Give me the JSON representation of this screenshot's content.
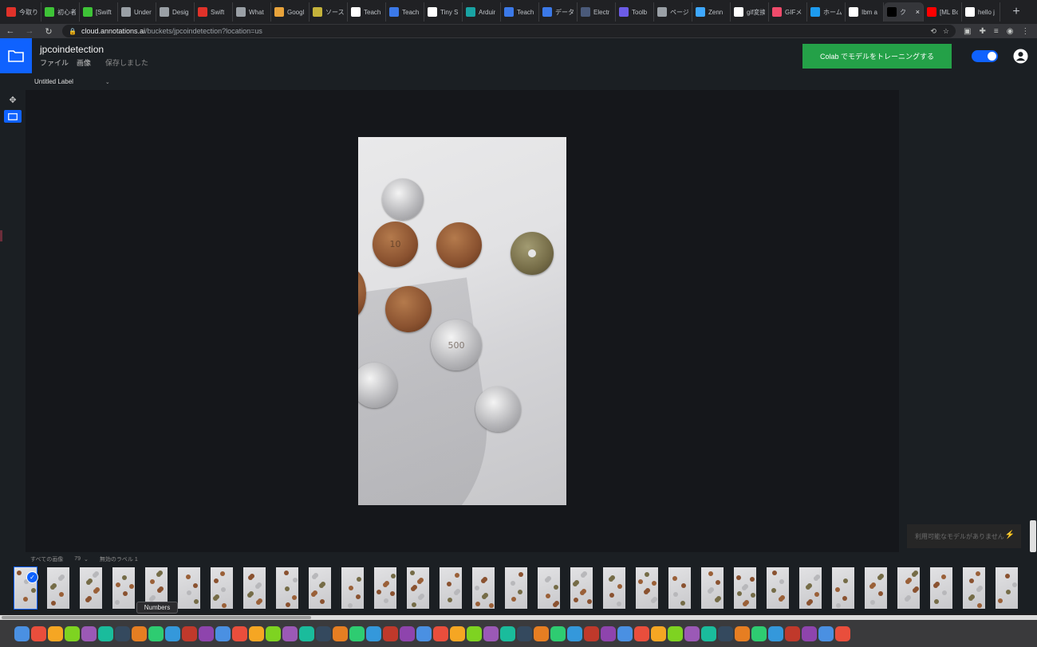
{
  "browser": {
    "tabs": [
      {
        "label": "今取り",
        "color": "#e0322a"
      },
      {
        "label": "初心者",
        "color": "#3ec337"
      },
      {
        "label": "[Swift",
        "color": "#3ec337"
      },
      {
        "label": "Under",
        "color": "#9aa0a6"
      },
      {
        "label": "Desig",
        "color": "#9aa0a6"
      },
      {
        "label": "Swift",
        "color": "#e0322a"
      },
      {
        "label": "What",
        "color": "#9aa0a6"
      },
      {
        "label": "Googl",
        "color": "#e8a33b"
      },
      {
        "label": "ソース",
        "color": "#c5b33b"
      },
      {
        "label": "Teach",
        "color": "#ffffff"
      },
      {
        "label": "Teach",
        "color": "#3b79e8"
      },
      {
        "label": "Tiny S",
        "color": "#ffffff"
      },
      {
        "label": "Arduir",
        "color": "#19a3a3"
      },
      {
        "label": "Teach",
        "color": "#3b79e8"
      },
      {
        "label": "データ",
        "color": "#3b79e8"
      },
      {
        "label": "Electr",
        "color": "#4a5a7a"
      },
      {
        "label": "Toolb",
        "color": "#6c5ce7"
      },
      {
        "label": "ページ",
        "color": "#9aa0a6"
      },
      {
        "label": "Zenn",
        "color": "#3ea8ff"
      },
      {
        "label": "gif変換",
        "color": "#ffffff"
      },
      {
        "label": "GIFメ",
        "color": "#ef4b6b"
      },
      {
        "label": "ホーム",
        "color": "#1d9bf0"
      },
      {
        "label": "Ibm a",
        "color": "#ffffff"
      },
      {
        "label": "ク",
        "color": "#000000",
        "active": true
      },
      {
        "label": "[ML Bo",
        "color": "#ff0000"
      },
      {
        "label": "hello j",
        "color": "#ffffff"
      }
    ],
    "close_tab_glyph": "×",
    "new_tab_glyph": "+",
    "url_host": "cloud.annotations.ai",
    "url_path": "/buckets/jpcoindetection?location=us"
  },
  "app": {
    "project_title": "jpcoindetection",
    "menu_file": "ファイル",
    "menu_image": "画像",
    "save_status": "保存しました",
    "colab_button": "Colab でモデルをトレーニングする",
    "accent": "#0f62fe",
    "colab_color": "#24a148"
  },
  "labels": {
    "selected_label": "Untitled Label"
  },
  "right_panel": {
    "model_placeholder": "利用可能なモデルがありません"
  },
  "filmstrip": {
    "filter_label": "すべての画像",
    "image_count": "79",
    "unlabeled_label": "無効のラベル",
    "unlabeled_count": "1",
    "thumbnail_count": 31,
    "tooltip": "Numbers"
  },
  "dock": {
    "icons": [
      "finder-icon",
      "launchpad-icon",
      "chrome-icon",
      "notes-icon",
      "photos-icon",
      "vlc-icon",
      "folder-icon",
      "pages-icon",
      "numbers-icon",
      "keynote-icon",
      "terminal-icon",
      "music-icon",
      "books-icon",
      "preview-icon",
      "imovie-icon",
      "photo-booth-icon",
      "pixelmator-icon",
      "automator-icon",
      "archive-icon",
      "app-store-icon",
      "system-preferences-icon",
      "gear-icon",
      "pycharm-icon",
      "flashprint-icon",
      "word-icon",
      "excel-icon",
      "powerpoint-icon",
      "onenote-icon",
      "reeder-icon",
      "safari-icon",
      "feedly-icon",
      "maps-icon",
      "github-icon",
      "xcode-icon",
      "android-icon",
      "arduino-icon",
      "vscode-icon",
      "transmit-icon",
      "postman-icon",
      "sourcetree-icon",
      "teams-icon",
      "slack-icon",
      "line-icon",
      "filezilla-icon",
      "affinity-icon",
      "xd-icon",
      "spark-icon",
      "zoom-icon",
      "finder2-icon",
      "trash-icon"
    ]
  }
}
